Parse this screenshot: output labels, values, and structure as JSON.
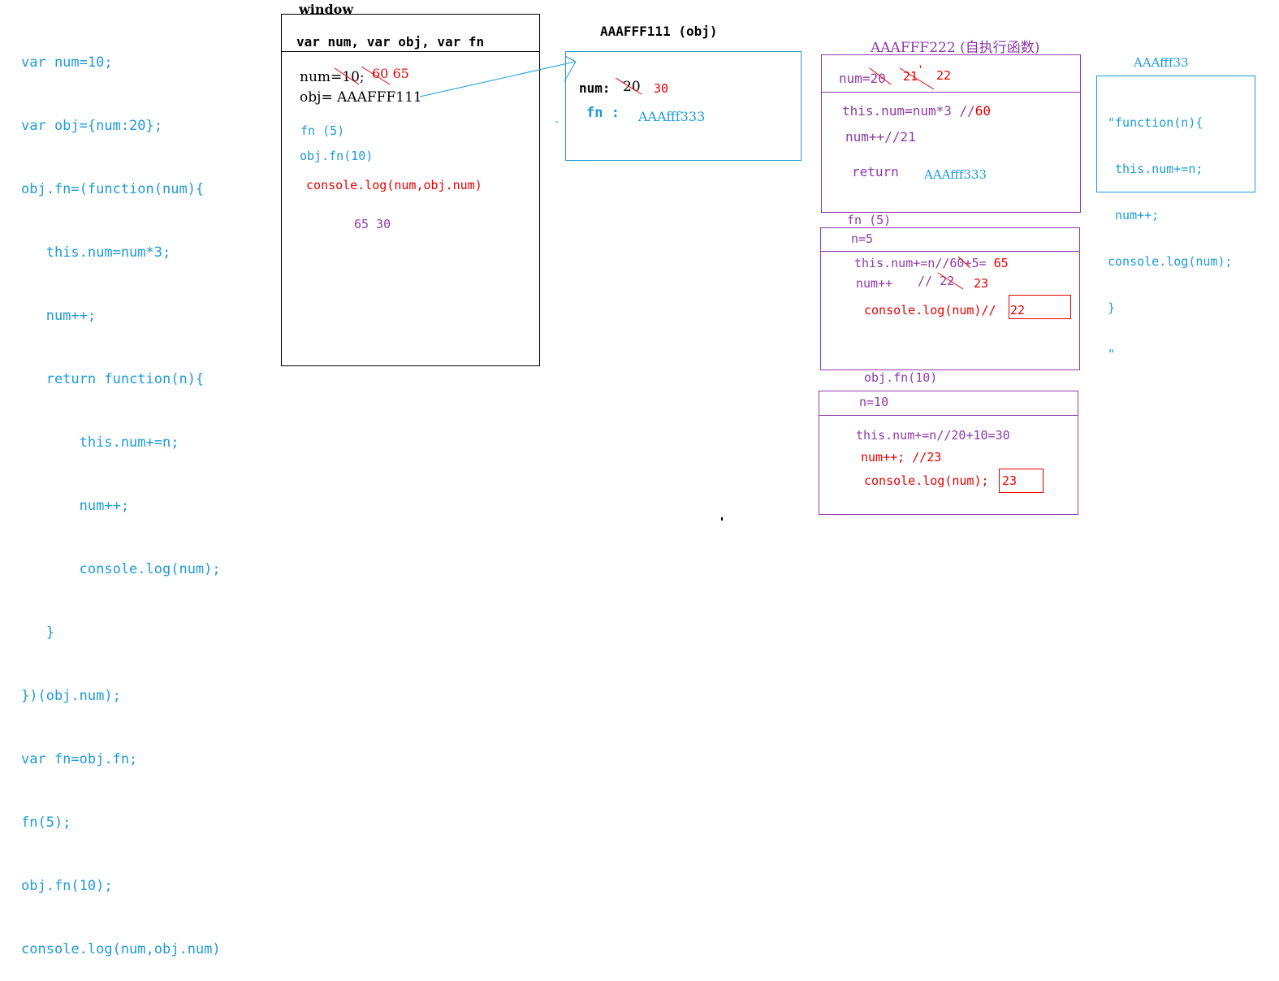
{
  "code": [
    "var num=10;",
    "var obj={num:20};",
    "obj.fn=(function(num){",
    "   this.num=num*3;",
    "   num++;",
    "   return function(n){",
    "       this.num+=n;",
    "       num++;",
    "       console.log(num);",
    "   }",
    "})(obj.num);",
    "var fn=obj.fn;",
    "fn(5);",
    "obj.fn(10);",
    "console.log(num,obj.num)"
  ],
  "window": {
    "title": "window",
    "header": "var num, var obj, var fn",
    "num_label": "num=10;",
    "num_updates": "60 65",
    "obj_label": "obj= AAAFFF111",
    "call1": "fn (5)",
    "call2": "obj.fn(10)",
    "log": "console.log(num,obj.num)",
    "result": "65 30"
  },
  "obj": {
    "title": "AAAFFF111 (obj)",
    "num_key": "num:",
    "num_old": "20",
    "num_new": "30",
    "fn_key": "fn :",
    "fn_val": "AAAfff333"
  },
  "iife": {
    "title": "AAAFFF222 (自执行函数)",
    "num_line": "num=20",
    "num_21": "21",
    "num_22": "22",
    "line1_a": "this.num=num*3 //",
    "line1_b": "60",
    "line2": "num++//21",
    "return_kw": "return",
    "return_val": "AAAfff333"
  },
  "heap33": {
    "title": "AAAfff33",
    "lines": [
      "\"function(n){",
      " this.num+=n;",
      " num++;",
      "console.log(num);",
      "}",
      "\""
    ]
  },
  "call_fn5": {
    "title": "fn (5)",
    "param": "n=5",
    "line1": "this.num+=n//60+5=",
    "line1_result": "65",
    "line2_a": "num++",
    "line2_b": "// 22",
    "line2_c": "23",
    "line3": "console.log(num)//",
    "result": "22"
  },
  "call_fn10": {
    "title": "obj.fn(10)",
    "param": "n=10",
    "line1": "this.num+=n//20+10=30",
    "line2": "num++; //23",
    "line3": "console.log(num);",
    "result": "23"
  },
  "colors": {
    "code_blue": "#1e9bd7",
    "red": "#e60000",
    "purple": "#8e3aa8"
  }
}
